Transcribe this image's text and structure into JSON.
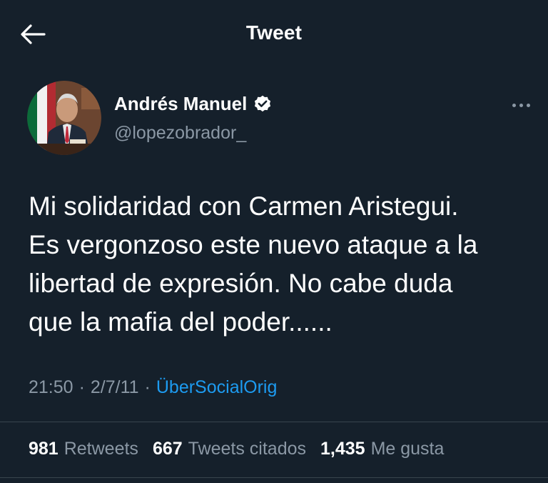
{
  "header": {
    "title": "Tweet",
    "back_icon": "arrow-left-icon"
  },
  "author": {
    "name": "Andrés Manuel",
    "handle": "@lopezobrador_",
    "verified_icon": "verified-badge-icon",
    "more_icon": "more-horizontal-icon"
  },
  "tweet": {
    "text": "Mi solidaridad con Carmen Aristegui.\nEs vergonzoso este nuevo ataque a la\nlibertad de expresión. No cabe duda\nque la mafia del poder......"
  },
  "meta": {
    "time": "21:50",
    "separator": "·",
    "date": "2/7/11",
    "source": "ÜberSocialOrig"
  },
  "stats": {
    "retweets_count": "981",
    "retweets_label": "Retweets",
    "quotes_count": "667",
    "quotes_label": "Tweets citados",
    "likes_count": "1,435",
    "likes_label": "Me gusta"
  },
  "colors": {
    "background": "#15202b",
    "text": "#ffffff",
    "secondary": "#8b98a5",
    "accent": "#1d9bf0",
    "divider": "#38444d"
  }
}
